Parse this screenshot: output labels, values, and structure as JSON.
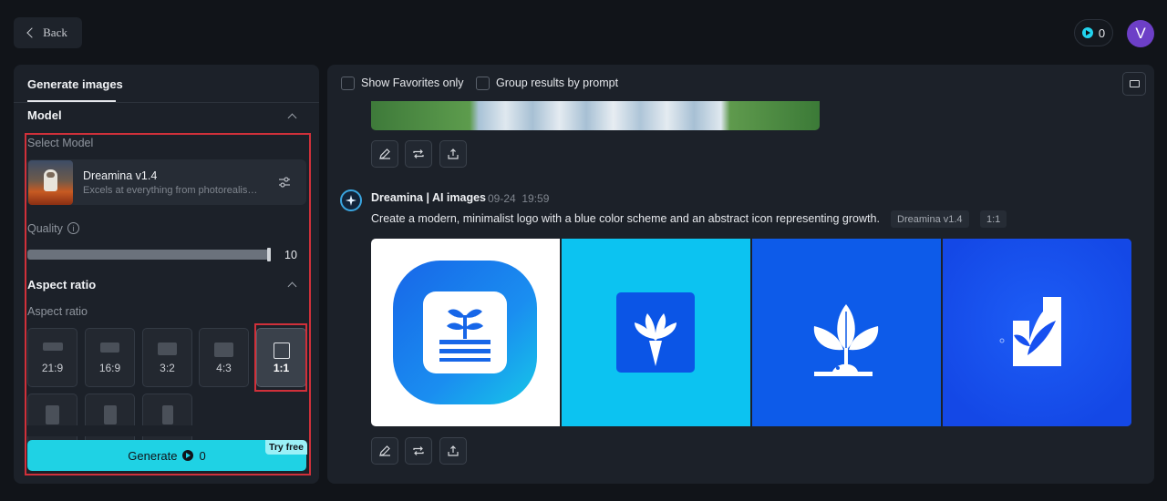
{
  "header": {
    "back_label": "Back",
    "credits": "0",
    "avatar_letter": "V"
  },
  "left": {
    "tab_title": "Generate images",
    "model_section": "Model",
    "select_model_label": "Select Model",
    "model_name": "Dreamina v1.4",
    "model_desc": "Excels at everything from photorealism to",
    "quality_label": "Quality",
    "quality_value": "10",
    "quality_fraction": 1.0,
    "aspect_section": "Aspect ratio",
    "aspect_label": "Aspect ratio",
    "ratios": [
      "21:9",
      "16:9",
      "3:2",
      "4:3",
      "1:1"
    ],
    "selected_ratio": "1:1",
    "generate_label": "Generate",
    "generate_cost": "0",
    "try_free": "Try free"
  },
  "right": {
    "show_favorites": "Show Favorites only",
    "group_results": "Group results by prompt",
    "bot_name": "Dreamina | AI images",
    "date": "09-24",
    "time": "19:59",
    "prompt": "Create a modern, minimalist logo with a blue color scheme and an abstract icon representing growth.",
    "tag_model": "Dreamina v1.4",
    "tag_ratio": "1:1"
  },
  "icons": {
    "back": "chevron-left-icon",
    "credits": "play-coin-icon",
    "tune": "sliders-icon",
    "info": "info-icon",
    "folder": "folder-icon",
    "edit": "pencil-icon",
    "regenerate": "repeat-icon",
    "export": "upload-icon"
  },
  "colors": {
    "accent": "#1fd2e4",
    "avatar": "#6d3fc7",
    "highlight_frame": "#d0303a"
  }
}
